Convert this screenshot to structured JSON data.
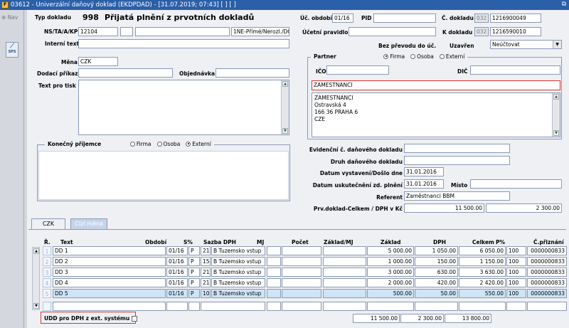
{
  "window": {
    "title": "03612 - Univerzální daňový doklad (EKDPDAD) - [31.07.2019; 07:43]  [ ]  [ ]",
    "restore_icon": "restore-icon"
  },
  "left": {
    "nav_label": "Nav",
    "sps_label": "SPS"
  },
  "header": {
    "typ_label": "Typ dokladu",
    "typ_value": "998",
    "typ_name": "Přijatá plnění z prvotních dokladů",
    "obdobi_label": "Úč. období",
    "obdobi_value": "01/16",
    "pid_label": "PID",
    "pid_value": "",
    "cdokladu_label": "Č. dokladu",
    "cdokladu_prefix": "032",
    "cdokladu_value": "1216900049",
    "ns_label": "NS/TA/A/KP",
    "ns_value": "12104",
    "ns_a": "",
    "ns_b": "",
    "ns_c": "1NE-Přímé/Nerozl./DČ-E",
    "ucetni_label": "Účetní pravidlo",
    "ucetni_value": "",
    "kdokladu_label": "K dokladu",
    "kdokladu_prefix": "032",
    "kdokladu_value": "1216590010",
    "interni_label": "Interní text",
    "interni_value": "",
    "bezprevodu_label": "Bez převodu do úč.",
    "uzavren_label": "Uzavřen",
    "uzavren_value": "Neúčtovat"
  },
  "body": {
    "mena_label": "Měna",
    "mena_value": "CZK",
    "dodaci_label": "Dodací příkaz",
    "dodaci_value": "",
    "objednavka_label": "Objednávka",
    "objednavka_value": "",
    "textprotisk_label": "Text pro tisk",
    "textprotisk_value": ""
  },
  "partner": {
    "title": "Partner",
    "radio_firma": "Firma",
    "radio_osoba": "Osoba",
    "radio_externi": "Externí",
    "ico_label": "IČO",
    "ico_value": "",
    "dic_label": "DIČ",
    "dic_value": "",
    "name_value": "ZAMESTNANCI",
    "address": [
      "ZAMESTNANCI",
      "Ostravská 4",
      "166 36 PRAHA 6",
      "CZE"
    ]
  },
  "konecny": {
    "title": "Konečný příjemce",
    "radio_firma": "Firma",
    "radio_osoba": "Osoba",
    "radio_externi": "Externí"
  },
  "docinfo": {
    "evidencni_label": "Evidenční č. daňového dokladu",
    "evidencni_value": "",
    "druh_label": "Druh daňového dokladu",
    "druh_value": "",
    "datumvyst_label": "Datum vystavení/Došlo dne",
    "datumvyst_value": "31.01.2016",
    "datumusk_label": "Datum uskutečnění zd. plnění",
    "datumusk_value": "31.01.2016",
    "misto_label": "Místo",
    "misto_value": "",
    "referent_label": "Referent",
    "referent_value": "Zaměstnanci BBM",
    "prv_label": "Prv.doklad-Celkem / DPH v Kč",
    "prv_celkem": "11 500.00",
    "prv_dph": "2 300.00"
  },
  "tabs": [
    "CZK",
    "Cizí měna"
  ],
  "grid": {
    "headers": {
      "r": "Ř.",
      "text": "Text",
      "obdobi": "Období",
      "s": "S%",
      "sazba": "Sazba DPH",
      "mj": "MJ",
      "pocet": "Počet",
      "zakladmj": "Základ/MJ",
      "zaklad": "Základ",
      "dph": "DPH",
      "celkem": "Celkem",
      "p": "P%",
      "cprizn": "Č.přiznání"
    },
    "rows": [
      {
        "n": "1",
        "text": "DD 1",
        "obdobi": "01/16",
        "s": "P",
        "sazbanum": "21",
        "sazba": "B Tuzemsko vstup",
        "zaklad": "5 000.00",
        "dph": "1 050.00",
        "celkem": "6 050.00",
        "p": "100",
        "cprizn": "0000000833"
      },
      {
        "n": "2",
        "text": "DD 2",
        "obdobi": "01/16",
        "s": "P",
        "sazbanum": "15",
        "sazba": "B Tuzemsko vstup",
        "zaklad": "1 000.00",
        "dph": "150.00",
        "celkem": "1 150.00",
        "p": "100",
        "cprizn": "0000000833"
      },
      {
        "n": "3",
        "text": "DD 3",
        "obdobi": "01/16",
        "s": "P",
        "sazbanum": "21",
        "sazba": "B Tuzemsko vstup",
        "zaklad": "3 000.00",
        "dph": "630.00",
        "celkem": "3 630.00",
        "p": "100",
        "cprizn": "0000000833"
      },
      {
        "n": "4",
        "text": "DD 4",
        "obdobi": "01/16",
        "s": "P",
        "sazbanum": "21",
        "sazba": "B Tuzemsko vstup",
        "zaklad": "2 000.00",
        "dph": "420.00",
        "celkem": "2 420.00",
        "p": "100",
        "cprizn": "0000000833"
      },
      {
        "n": "5",
        "text": "DD 5",
        "obdobi": "01/16",
        "s": "P",
        "sazbanum": "10",
        "sazba": "B Tuzemsko vstup",
        "zaklad": "500.00",
        "dph": "50.00",
        "celkem": "550.00",
        "p": "100",
        "cprizn": "0000000833"
      }
    ],
    "totals": {
      "zaklad": "11 500.00",
      "dph": "2 300.00",
      "celkem": "13 800.00"
    }
  },
  "footer": {
    "udd_label": "UDD pro DPH z ext. systému"
  },
  "colors": {
    "titlebar": "#2b5fa8",
    "selected_row": "#cfe4f7",
    "highlight_border": "#e03030"
  }
}
